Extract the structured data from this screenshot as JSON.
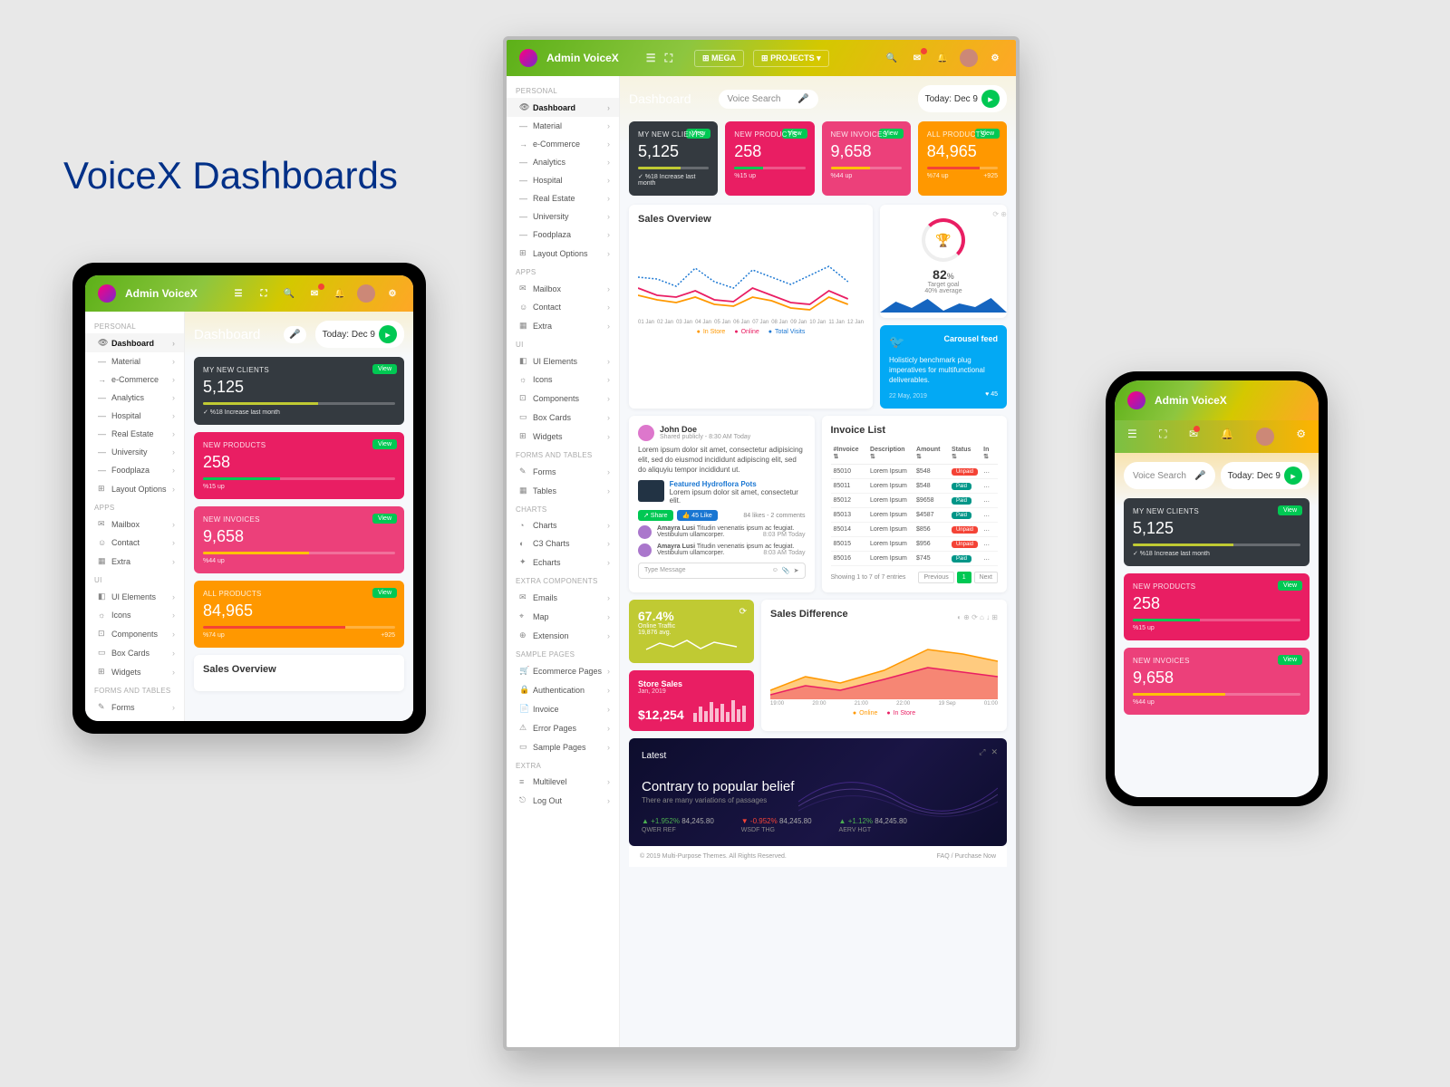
{
  "page_heading": "VoiceX Dashboards",
  "brand": "Admin VoiceX",
  "nav": {
    "mega": "MEGA",
    "projects": "PROJECTS"
  },
  "header": {
    "search_placeholder": "Voice Search",
    "date_label": "Today: Dec 9",
    "dashboard_title": "Dashboard"
  },
  "sidebar": {
    "sections": [
      {
        "label": "PERSONAL",
        "items": [
          {
            "label": "Dashboard",
            "icon": "👁",
            "active": true,
            "expand": true
          },
          {
            "label": "Material",
            "icon": "—",
            "sub": true
          },
          {
            "label": "e-Commerce",
            "icon": "→",
            "sub": true,
            "active_sub": true
          },
          {
            "label": "Analytics",
            "icon": "—",
            "sub": true
          },
          {
            "label": "Hospital",
            "icon": "—",
            "sub": true
          },
          {
            "label": "Real Estate",
            "icon": "—",
            "sub": true
          },
          {
            "label": "University",
            "icon": "—",
            "sub": true
          },
          {
            "label": "Foodplaza",
            "icon": "—",
            "sub": true
          },
          {
            "label": "Layout Options",
            "icon": "⊞"
          }
        ]
      },
      {
        "label": "APPS",
        "items": [
          {
            "label": "Mailbox",
            "icon": "✉"
          },
          {
            "label": "Contact",
            "icon": "☺"
          },
          {
            "label": "Extra",
            "icon": "▦"
          }
        ]
      },
      {
        "label": "UI",
        "items": [
          {
            "label": "UI Elements",
            "icon": "◧"
          },
          {
            "label": "Icons",
            "icon": "☼"
          },
          {
            "label": "Components",
            "icon": "⊡"
          },
          {
            "label": "Box Cards",
            "icon": "▭"
          },
          {
            "label": "Widgets",
            "icon": "⊞"
          }
        ]
      },
      {
        "label": "FORMS And TABLES",
        "items": [
          {
            "label": "Forms",
            "icon": "✎"
          },
          {
            "label": "Tables",
            "icon": "▦"
          }
        ]
      },
      {
        "label": "CHARTS",
        "items": [
          {
            "label": "Charts",
            "icon": "◔"
          },
          {
            "label": "C3 Charts",
            "icon": "◐"
          },
          {
            "label": "Echarts",
            "icon": "✦"
          }
        ]
      },
      {
        "label": "EXTRA COMPONENTS",
        "items": [
          {
            "label": "Emails",
            "icon": "✉"
          },
          {
            "label": "Map",
            "icon": "⌖"
          },
          {
            "label": "Extension",
            "icon": "⊕"
          }
        ]
      },
      {
        "label": "SAMPLE PAGES",
        "items": [
          {
            "label": "Ecommerce Pages",
            "icon": "🛒"
          },
          {
            "label": "Authentication",
            "icon": "🔒"
          },
          {
            "label": "Invoice",
            "icon": "📄"
          },
          {
            "label": "Error Pages",
            "icon": "⚠"
          },
          {
            "label": "Sample Pages",
            "icon": "▭"
          }
        ]
      },
      {
        "label": "EXTRA",
        "items": [
          {
            "label": "Multilevel",
            "icon": "≡"
          },
          {
            "label": "Log Out",
            "icon": "⎋"
          }
        ]
      }
    ]
  },
  "stat_cards": [
    {
      "label": "MY NEW CLIENTS",
      "value": "5,125",
      "view": "View",
      "note": "✓ %18 Increase last month",
      "bar_pct": 60,
      "bar_color": "#c0ca33",
      "class": "c-dark"
    },
    {
      "label": "NEW PRODUCTS",
      "value": "258",
      "view": "View",
      "note": "%15 up",
      "bar_pct": 40,
      "bar_color": "#00c853",
      "class": "c-pink"
    },
    {
      "label": "NEW INVOICES",
      "value": "9,658",
      "view": "View",
      "note": "%44 up",
      "bar_pct": 55,
      "bar_color": "#ffc107",
      "class": "c-pink2"
    },
    {
      "label": "ALL PRODUCTS",
      "value": "84,965",
      "view": "View",
      "note": "%74 up",
      "bar_pct": 74,
      "bar_color": "#f44336",
      "trailing": "+925",
      "class": "c-orange"
    }
  ],
  "sales_overview": {
    "title": "Sales Overview",
    "legend": [
      "In Store",
      "Online",
      "Total Visits"
    ],
    "xaxis": [
      "01 Jan",
      "02 Jan",
      "03 Jan",
      "04 Jan",
      "05 Jan",
      "06 Jan",
      "07 Jan",
      "08 Jan",
      "09 Jan",
      "10 Jan",
      "11 Jan",
      "12 Jan"
    ]
  },
  "target": {
    "pct": "82",
    "unit": "%",
    "label": "Target goal",
    "sub": "40% average"
  },
  "twitter": {
    "title": "Carousel feed",
    "text": "Holisticly benchmark plug imperatives for multifunctional deliverables.",
    "date": "22 May, 2019",
    "likes": "♥ 45"
  },
  "feed": {
    "user": "John Doe",
    "meta": "Shared publicly - 8:30 AM Today",
    "body": "Lorem ipsum dolor sit amet, consectetur adipisicing elit, sed do eiusmod incididunt adipiscing elit, sed do aliquyiu tempor incididunt ut.",
    "featured_title": "Featured Hydroflora Pots",
    "featured_desc": "Lorem ipsum dolor sit amet, consectetur elit.",
    "share": "Share",
    "like_count": "45 Like",
    "comments_meta": "84 likes - 2 comments",
    "comments": [
      {
        "name": "Amayra Lusi",
        "text": "Titudin venenatis ipsum ac feugiat. Vestibulum ullamcorper.",
        "time": "8:03 PM Today"
      },
      {
        "name": "Amayra Lusi",
        "text": "Titudin venenatis ipsum ac feugiat. Vestibulum ullamcorper.",
        "time": "8:03 AM Today"
      }
    ],
    "msg_placeholder": "Type Message"
  },
  "invoices": {
    "title": "Invoice List",
    "columns": [
      "#Invoice",
      "Description",
      "Amount",
      "Status",
      "In"
    ],
    "rows": [
      {
        "id": "85010",
        "desc": "Lorem Ipsum",
        "amt": "$548",
        "status": "Unpaid"
      },
      {
        "id": "85011",
        "desc": "Lorem Ipsum",
        "amt": "$548",
        "status": "Paid"
      },
      {
        "id": "85012",
        "desc": "Lorem Ipsum",
        "amt": "$9658",
        "status": "Paid"
      },
      {
        "id": "85013",
        "desc": "Lorem Ipsum",
        "amt": "$4587",
        "status": "Paid"
      },
      {
        "id": "85014",
        "desc": "Lorem Ipsum",
        "amt": "$856",
        "status": "Unpaid"
      },
      {
        "id": "85015",
        "desc": "Lorem Ipsum",
        "amt": "$956",
        "status": "Unpaid"
      },
      {
        "id": "85016",
        "desc": "Lorem Ipsum",
        "amt": "$745",
        "status": "Paid"
      }
    ],
    "pager_text": "Showing 1 to 7 of 7 entries",
    "prev": "Previous",
    "next": "Next"
  },
  "traffic": {
    "pct": "67.4%",
    "label": "Online Traffic",
    "sub": "19,876 avg."
  },
  "store_sales": {
    "title": "Store Sales",
    "period": "Jan, 2019",
    "value": "$12,254"
  },
  "sales_diff": {
    "title": "Sales Difference",
    "legend": [
      "Online",
      "In Store"
    ],
    "xaxis": [
      "19:00",
      "20:00",
      "21:00",
      "22:00",
      "19 Sep",
      "01:00"
    ]
  },
  "latest": {
    "title": "Latest",
    "headline": "Contrary to popular belief",
    "sub": "There are many variations of passages",
    "stocks": [
      {
        "change": "+1.952%",
        "price": "84,245.80",
        "sym": "QWER REF",
        "dir": "up"
      },
      {
        "change": "-0.952%",
        "price": "84,245.80",
        "sym": "WSDF THG",
        "dir": "down"
      },
      {
        "change": "+1.12%",
        "price": "84,245.80",
        "sym": "AERV HGT",
        "dir": "up"
      }
    ]
  },
  "footer": {
    "copy": "© 2019 Multi-Purpose Themes. All Rights Reserved.",
    "links": "FAQ  /  Purchase Now"
  },
  "chart_data": [
    {
      "type": "line",
      "title": "Sales Overview",
      "x": [
        "01 Jan",
        "02 Jan",
        "03 Jan",
        "04 Jan",
        "05 Jan",
        "06 Jan",
        "07 Jan",
        "08 Jan",
        "09 Jan",
        "10 Jan",
        "11 Jan",
        "12 Jan"
      ],
      "series": [
        {
          "name": "In Store",
          "values": [
            25,
            20,
            18,
            22,
            15,
            14,
            20,
            18,
            12,
            10,
            20,
            15
          ],
          "color": "#ff9800"
        },
        {
          "name": "Online",
          "values": [
            35,
            25,
            22,
            28,
            20,
            18,
            30,
            25,
            18,
            15,
            28,
            20
          ],
          "color": "#e91e63"
        },
        {
          "name": "Total Visits",
          "values": [
            45,
            48,
            35,
            55,
            40,
            30,
            52,
            42,
            35,
            48,
            55,
            40
          ],
          "color": "#1976d2"
        }
      ],
      "ylim": [
        0,
        60
      ]
    },
    {
      "type": "area",
      "title": "Sales Difference",
      "x": [
        "19:00",
        "20:00",
        "21:00",
        "22:00",
        "19 Sep",
        "01:00"
      ],
      "series": [
        {
          "name": "Online",
          "values": [
            12,
            18,
            14,
            25,
            40,
            35
          ],
          "color": "#ff9800"
        },
        {
          "name": "In Store",
          "values": [
            8,
            12,
            10,
            18,
            28,
            22
          ],
          "color": "#e91e63"
        }
      ],
      "ylim": [
        0,
        45
      ]
    }
  ]
}
